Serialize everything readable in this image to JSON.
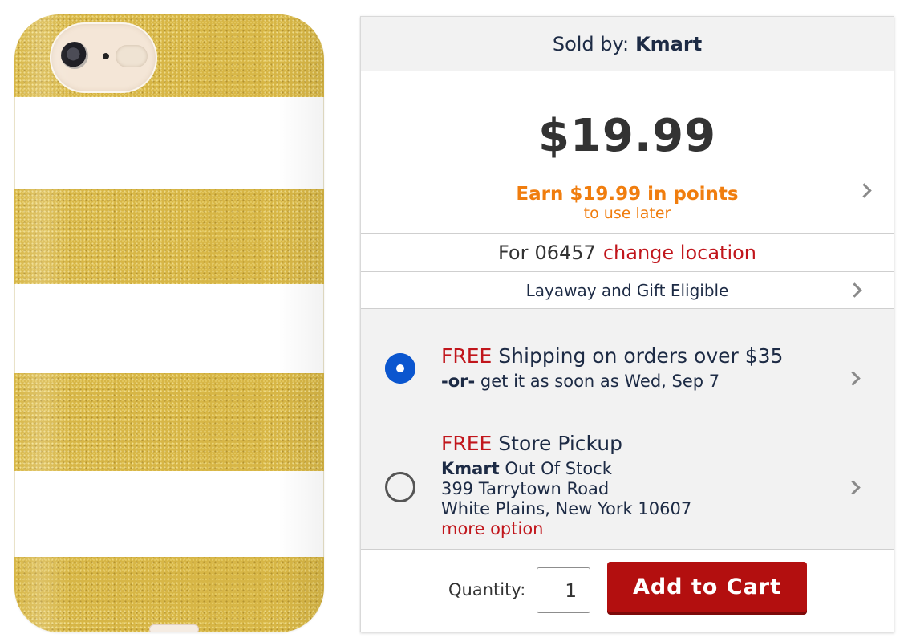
{
  "seller": {
    "label": "Sold by:",
    "name": "Kmart"
  },
  "pricing": {
    "price": "$19.99",
    "points_main": "Earn $19.99 in points",
    "points_sub": "to use later"
  },
  "location": {
    "prefix": "For",
    "zip": "06457",
    "change_label": "change location"
  },
  "layaway": {
    "label": "Layaway and Gift Eligible"
  },
  "shipping_option": {
    "free": "FREE",
    "title": "Shipping on orders over $35",
    "or": "-or-",
    "eta": "get it as soon as Wed, Sep 7",
    "selected": true
  },
  "pickup_option": {
    "free": "FREE",
    "title": "Store Pickup",
    "store": "Kmart",
    "stock": "Out Of Stock",
    "address1": "399 Tarrytown Road",
    "address2": "White Plains, New York 10607",
    "more_label": "more option",
    "selected": false
  },
  "cart": {
    "quantity_label": "Quantity:",
    "quantity_value": "1",
    "add_label": "Add to Cart"
  },
  "colors": {
    "accent_red": "#c1161c",
    "button_red": "#b30f0f",
    "points_orange": "#f07d0e",
    "radio_blue": "#0b56cf",
    "case_gold": "#d7b646"
  },
  "icons": [
    "chevron-right-icon",
    "radio-selected-icon",
    "radio-unselected-icon"
  ]
}
